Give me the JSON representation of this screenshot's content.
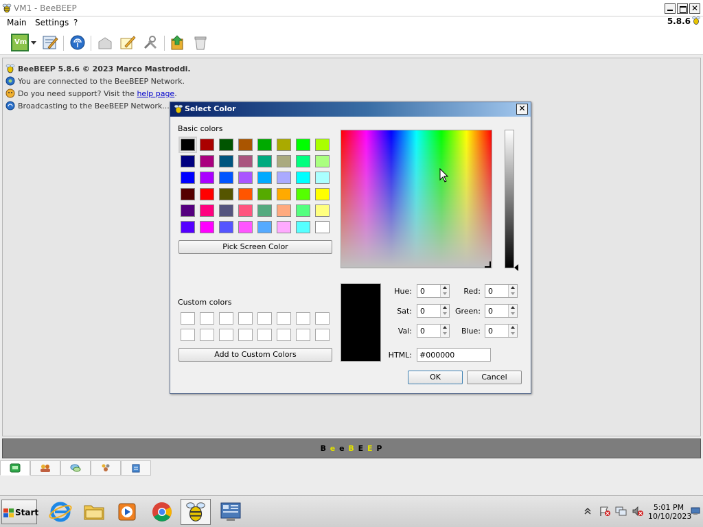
{
  "window": {
    "title": "VM1 - BeeBEEP",
    "version": "5.8.6",
    "controls": {
      "minimize": "",
      "maximize": "",
      "close": "✕"
    }
  },
  "menu": [
    "Main",
    "Settings",
    "?"
  ],
  "toolbar": {
    "icons": [
      "vm-avatar-icon",
      "dropdown-arrow-icon",
      "edit-profile-icon",
      "network-icon",
      "inbox-icon",
      "note-icon",
      "settings-tools-icon",
      "refresh-icon",
      "trash-icon"
    ]
  },
  "log": {
    "header": "BeeBEEP 5.8.6 © 2023 Marco Mastroddi.",
    "connected": "You are connected to the BeeBEEP Network.",
    "support_prefix": "Do you need support? Visit the ",
    "support_link": "help page",
    "support_suffix": ".",
    "broadcasting": "Broadcasting to the BeeBEEP Network..."
  },
  "brand": {
    "letters": [
      "B",
      "e",
      "e",
      "B",
      "E",
      "E",
      "P"
    ],
    "colors": [
      "#000000",
      "#e0e000",
      "#000000",
      "#e0e000",
      "#000000",
      "#e0e000",
      "#000000"
    ]
  },
  "bottom_tabs": [
    "chat-tab-icon",
    "users-tab-icon",
    "chats-tab-icon",
    "groups-tab-icon",
    "files-tab-icon"
  ],
  "dialog": {
    "title": "Select Color",
    "close": "✕",
    "basic_colors_label": "Basic colors",
    "basic_colors": [
      "#000000",
      "#aa0000",
      "#005500",
      "#aa5500",
      "#00aa00",
      "#aaaa00",
      "#00ff00",
      "#aaff00",
      "#00007f",
      "#aa007f",
      "#00557f",
      "#aa557f",
      "#00aa7f",
      "#aaaa7f",
      "#00ff7f",
      "#aaff7f",
      "#0000ff",
      "#aa00ff",
      "#0055ff",
      "#aa55ff",
      "#00aaff",
      "#aaaaff",
      "#00ffff",
      "#aaffff",
      "#550000",
      "#ff0000",
      "#555500",
      "#ff5500",
      "#55aa00",
      "#ffaa00",
      "#55ff00",
      "#ffff00",
      "#55007f",
      "#ff007f",
      "#55557f",
      "#ff557f",
      "#55aa7f",
      "#ffaa7f",
      "#55ff7f",
      "#ffff7f",
      "#5500ff",
      "#ff00ff",
      "#5555ff",
      "#ff55ff",
      "#55aaff",
      "#ffaaff",
      "#55ffff",
      "#ffffff"
    ],
    "pick_screen_color": "Pick Screen Color",
    "custom_colors_label": "Custom colors",
    "add_custom": "Add to Custom Colors",
    "current_color": "#000000",
    "fields": {
      "hue_label": "Hue:",
      "hue": "0",
      "sat_label": "Sat:",
      "sat": "0",
      "val_label": "Val:",
      "val": "0",
      "red_label": "Red:",
      "red": "0",
      "green_label": "Green:",
      "green": "0",
      "blue_label": "Blue:",
      "blue": "0",
      "html_label": "HTML:",
      "html": "#000000"
    },
    "ok": "OK",
    "cancel": "Cancel"
  },
  "taskbar": {
    "start": "Start",
    "apps": [
      "internet-explorer-icon",
      "file-explorer-icon",
      "media-player-icon",
      "chrome-icon",
      "beebeep-icon",
      "server-manager-icon"
    ],
    "tray": [
      "show-hidden-icons-icon",
      "action-center-icon",
      "network-status-icon",
      "volume-muted-icon"
    ],
    "time": "5:01 PM",
    "date": "10/10/2023"
  }
}
